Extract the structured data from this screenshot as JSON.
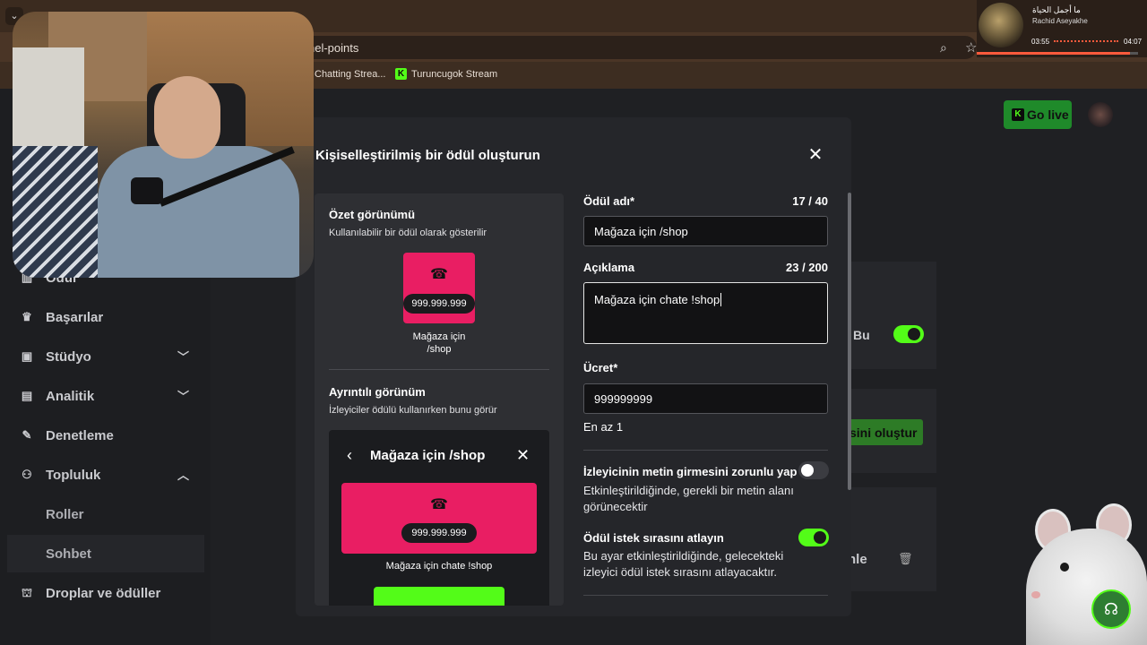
{
  "browser": {
    "url": "nel-points",
    "bookmarks": [
      "Chatting Strea...",
      "Turuncugok Stream"
    ]
  },
  "media": {
    "title": "ما أجمل الحياة",
    "artist": "Rachid Aseyakhe",
    "elapsed": "03:55",
    "duration": "04:07",
    "progress": 0.95
  },
  "header": {
    "go_live": "Go live"
  },
  "sidebar": {
    "items": [
      {
        "label": "Ödül",
        "icon": "chart-icon"
      },
      {
        "label": "Başarılar",
        "icon": "trophy-icon"
      },
      {
        "label": "Stüdyo",
        "icon": "studio-icon"
      },
      {
        "label": "Analitik",
        "icon": "analytics-icon"
      },
      {
        "label": "Denetleme",
        "icon": "wrench-icon"
      },
      {
        "label": "Topluluk",
        "icon": "community-icon"
      },
      {
        "label": "Droplar ve ödüller",
        "icon": "drops-icon"
      }
    ],
    "sub_items": [
      "Roller",
      "Sohbet"
    ]
  },
  "background_page": {
    "toggle_label": "Bu",
    "create_button": "sini oluştur",
    "row_text": "nle"
  },
  "modal": {
    "title": "Kişiselleştirilmiş bir ödül oluşturun",
    "preview": {
      "summary_title": "Özet görünümü",
      "summary_subtitle": "Kullanılabilir bir ödül olarak gösterilir",
      "price": "999.999.999",
      "reward_name_line1": "Mağaza için",
      "reward_name_line2": "/shop",
      "detail_title": "Ayrıntılı görünüm",
      "detail_subtitle": "İzleyiciler ödülü kullanırken bunu görür",
      "detail_name": "Mağaza için /shop",
      "detail_description": "Mağaza için chate !shop",
      "card_color": "#e91e63"
    },
    "form": {
      "name_label": "Ödül adı*",
      "name_count": "17 / 40",
      "name_value": "Mağaza için /shop",
      "desc_label": "Açıklama",
      "desc_count": "23 / 200",
      "desc_value": "Mağaza için chate !shop",
      "cost_label": "Ücret*",
      "cost_value": "999999999",
      "cost_hint": "En az 1",
      "text_required_title": "İzleyicinin metin girmesini zorunlu yap",
      "text_required_desc": "Etkinleştirildiğinde, gerekli bir metin alanı görünecektir",
      "text_required_on": false,
      "skip_queue_title": "Ödül istek sırasını atlayın",
      "skip_queue_desc": "Bu ayar etkinleştirildiğinde, gelecekteki izleyici ödül istek sırasını atlayacaktır.",
      "skip_queue_on": true
    }
  },
  "colors": {
    "accent": "#53fc18",
    "card": "#e91e63",
    "modal_bg": "#25262a"
  }
}
